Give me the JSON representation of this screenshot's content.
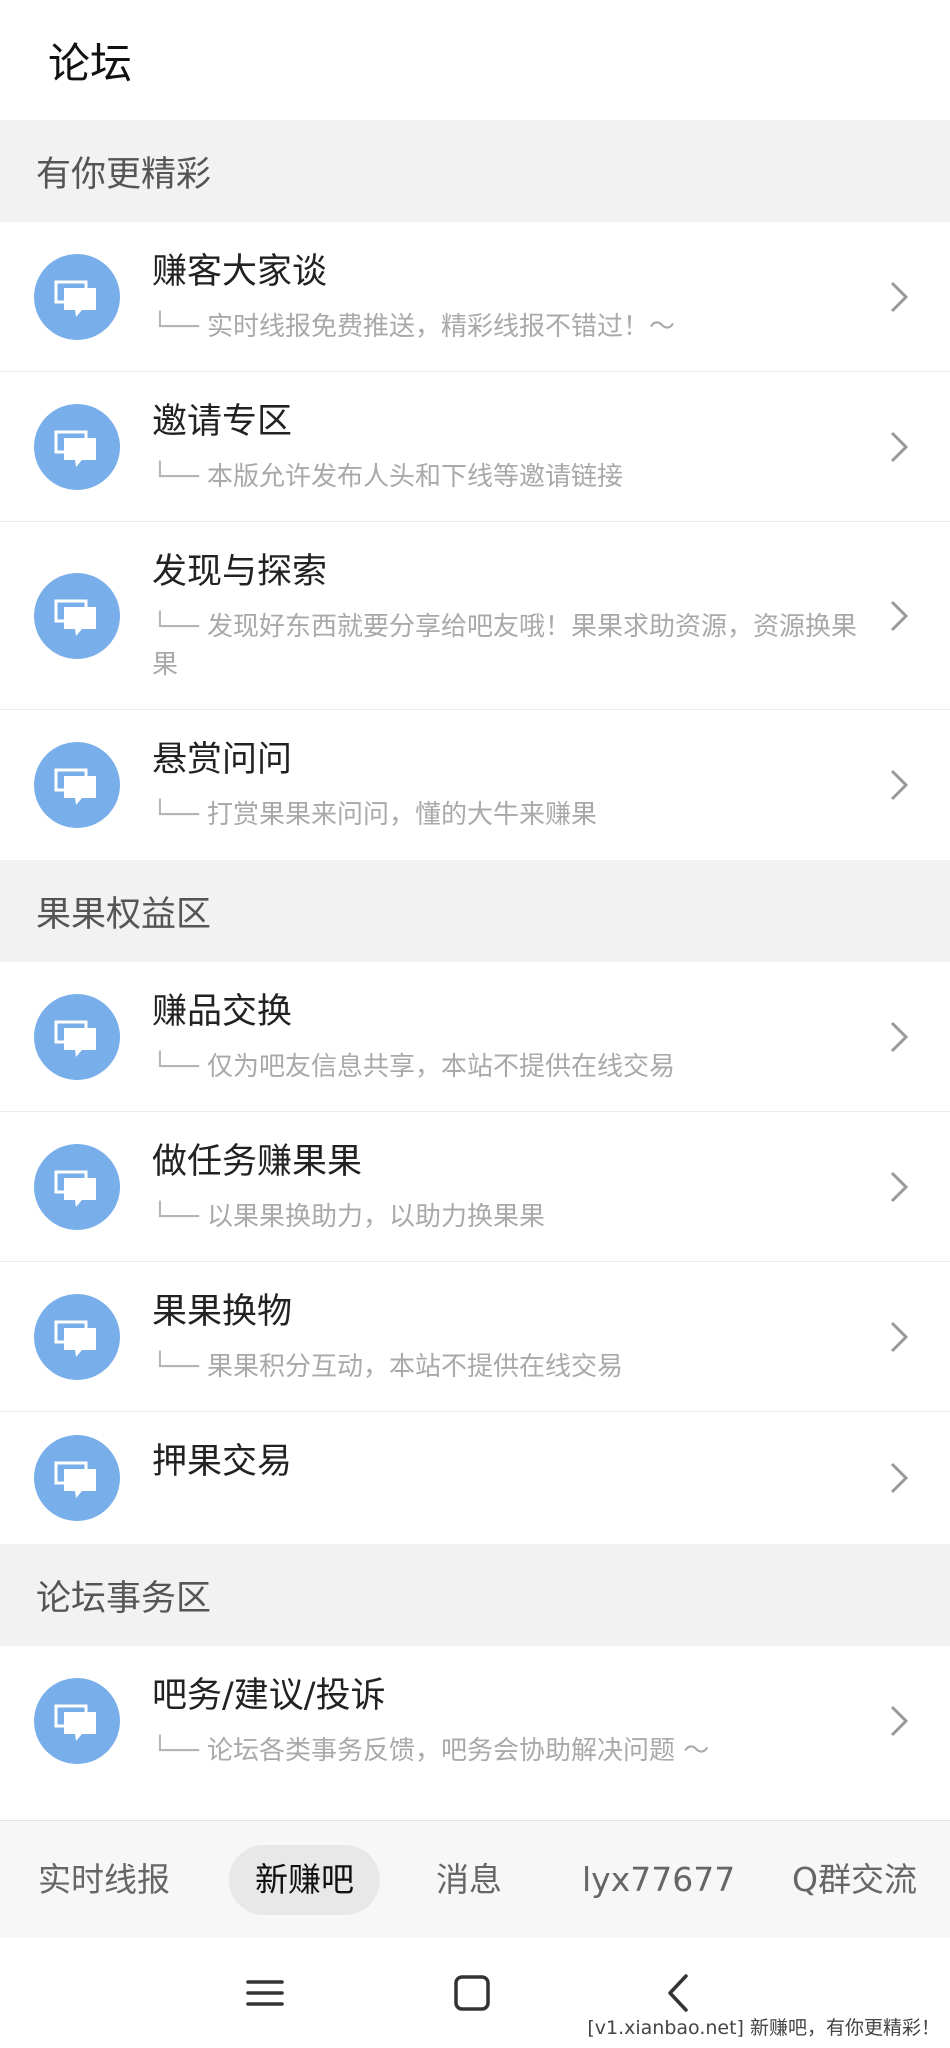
{
  "header": {
    "title": "论坛"
  },
  "sections": [
    {
      "title": "有你更精彩",
      "items": [
        {
          "title": "赚客大家谈",
          "desc": "实时线报免费推送，精彩线报不错过！～"
        },
        {
          "title": "邀请专区",
          "desc": "本版允许发布人头和下线等邀请链接"
        },
        {
          "title": "发现与探索",
          "desc": "发现好东西就要分享给吧友哦！果果求助资源，资源换果果"
        },
        {
          "title": "悬赏问问",
          "desc": "打赏果果来问问，懂的大牛来赚果"
        }
      ]
    },
    {
      "title": "果果权益区",
      "items": [
        {
          "title": "赚品交换",
          "desc": "仅为吧友信息共享，本站不提供在线交易"
        },
        {
          "title": "做任务赚果果",
          "desc": "以果果换助力，以助力换果果"
        },
        {
          "title": "果果换物",
          "desc": "果果积分互动，本站不提供在线交易"
        },
        {
          "title": "押果交易",
          "desc": ""
        }
      ]
    },
    {
      "title": "论坛事务区",
      "items": [
        {
          "title": "吧务/建议/投诉",
          "desc": "论坛各类事务反馈，吧务会协助解决问题 ～"
        }
      ]
    }
  ],
  "tree_prefix": "└──",
  "tabs": [
    {
      "label": "实时线报",
      "active": false
    },
    {
      "label": "新赚吧",
      "active": true
    },
    {
      "label": "消息",
      "active": false
    },
    {
      "label": "lyx77677",
      "active": false
    },
    {
      "label": "Q群交流",
      "active": false
    }
  ],
  "watermark": "[v1.xianbao.net] 新赚吧，有你更精彩！",
  "colors": {
    "icon_bg": "#78aeea",
    "section_bg": "#f2f2f2",
    "desc_text": "#a9a9a9"
  },
  "icons": {
    "forum": "chat-bubble-icon",
    "arrow": "chevron-right-icon"
  }
}
